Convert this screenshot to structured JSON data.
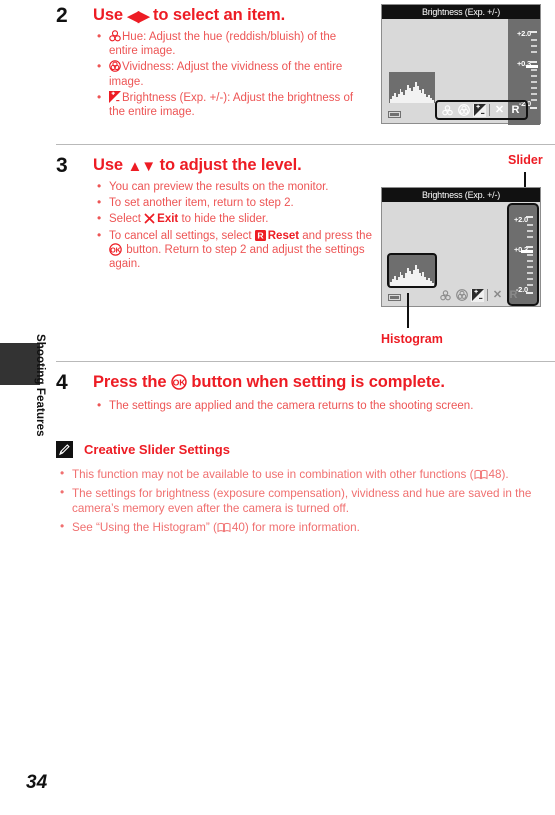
{
  "page": {
    "number": "34",
    "chapter": "Shooting Features"
  },
  "steps": [
    {
      "number": "2",
      "title_pre": "Use ",
      "title_arrows": "◀▶",
      "title_post": " to select an item.",
      "bullets": [
        {
          "icon": "hue-icon",
          "text": "Hue: Adjust the hue (reddish/bluish) of the entire image."
        },
        {
          "icon": "vividness-icon",
          "text": "Vividness: Adjust the vividness of the entire image."
        },
        {
          "icon": "brightness-icon",
          "text": "Brightness (Exp. +/-): Adjust the brightness of the entire image."
        }
      ]
    },
    {
      "number": "3",
      "title_pre": "Use ",
      "title_arrows": "▲▼",
      "title_post": " to adjust the level.",
      "bullets": [
        {
          "text": "You can preview the results on the monitor."
        },
        {
          "text": "To set another item, return to step 2."
        },
        {
          "text_pre": "Select ",
          "bold_icon": "exit-icon",
          "bold": "Exit",
          "text_post": " to hide the slider."
        },
        {
          "text_pre": "To cancel all settings, select ",
          "bold_icon": "reset-icon",
          "bold": "Reset",
          "text_post": " and press the ",
          "ok_icon": "ok-button-icon",
          "text_end": " button. Return to step 2 and adjust the settings again."
        }
      ]
    },
    {
      "number": "4",
      "title_pre": "Press the ",
      "ok_icon": "ok-button-icon",
      "title_post": " button when setting is complete.",
      "bullets": [
        {
          "text": "The settings are applied and the camera returns to the shooting screen."
        }
      ]
    }
  ],
  "note": {
    "icon": "pencil-note-icon",
    "title": "Creative Slider Settings",
    "bullets": [
      {
        "pre": "This function may not be available to use in combination with other functions (",
        "book_icon": "book-icon",
        "ref": "48",
        "post": ")."
      },
      {
        "pre": "The settings for brightness (exposure compensation), vividness and hue are saved in the camera’s memory even after the camera is turned off.",
        "post": ""
      },
      {
        "pre": "See “Using the Histogram” (",
        "book_icon": "book-icon",
        "ref": "40",
        "post": ") for more information."
      }
    ]
  },
  "camera_screen_1": {
    "title": "Brightness (Exp. +/-)",
    "slider": {
      "top_label": "+2.0",
      "mid_label": "+0.3",
      "bottom_label": "-2.0"
    },
    "toolbar": {
      "items": [
        "hue-icon",
        "vividness-icon",
        "brightness-icon",
        "exit-icon",
        "reset-icon"
      ],
      "exit_label": "✕",
      "reset_label": "R",
      "selected": "brightness-icon"
    },
    "status": "battery-icon",
    "histogram": "histogram"
  },
  "camera_screen_2": {
    "title": "Brightness (Exp. +/-)",
    "slider": {
      "top_label": "+2.0",
      "mid_label": "+0.3",
      "bottom_label": "-2.0"
    },
    "toolbar": {
      "items": [
        "hue-icon",
        "vividness-icon",
        "brightness-icon",
        "exit-icon",
        "reset-icon"
      ],
      "exit_label": "✕",
      "reset_label": "R",
      "selected": "brightness-icon"
    },
    "status": "battery-icon",
    "histogram": "histogram"
  },
  "callouts": {
    "slider": "Slider",
    "histogram": "Histogram"
  }
}
